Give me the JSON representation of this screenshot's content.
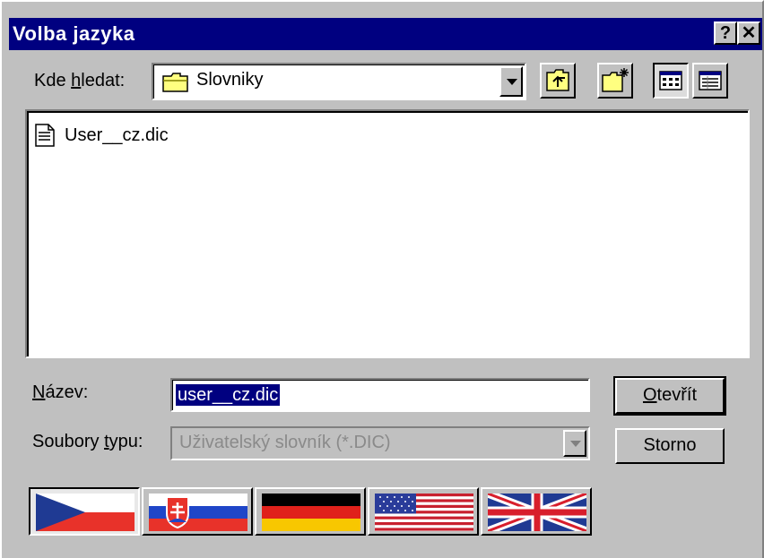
{
  "window": {
    "title": "Volba jazyka",
    "help_glyph": "?",
    "close_glyph": "✕"
  },
  "look_in": {
    "label_prefix": "Kde ",
    "label_accel": "h",
    "label_suffix": "ledat:",
    "value": "Slovniky",
    "icon": "folder-icon"
  },
  "toolbar": {
    "buttons": [
      {
        "name": "up-one-level",
        "icon": "folder-up-icon"
      },
      {
        "name": "create-new-folder",
        "icon": "new-folder-icon"
      },
      {
        "name": "list-view",
        "icon": "list-view-icon",
        "active": true
      },
      {
        "name": "details-view",
        "icon": "details-view-icon"
      }
    ]
  },
  "files": [
    {
      "name": "User__cz.dic",
      "icon": "document-icon"
    }
  ],
  "filename": {
    "label_accel": "N",
    "label_rest": "ázev:",
    "value": "user__cz.dic"
  },
  "filetype": {
    "label_prefix": "Soubory ",
    "label_accel": "t",
    "label_suffix": "ypu:",
    "value": "Uživatelský slovník (*.DIC)"
  },
  "buttons": {
    "open_accel": "O",
    "open_rest": "tevřít",
    "cancel": "Storno"
  },
  "languages": [
    {
      "name": "czech",
      "icon": "czech-flag-icon",
      "selected": true
    },
    {
      "name": "slovak",
      "icon": "slovak-flag-icon",
      "selected": false
    },
    {
      "name": "german",
      "icon": "german-flag-icon",
      "selected": false
    },
    {
      "name": "usa",
      "icon": "usa-flag-icon",
      "selected": false
    },
    {
      "name": "uk",
      "icon": "uk-flag-icon",
      "selected": false
    }
  ],
  "colors": {
    "titlebar": "#000080",
    "face": "#c0c0c0",
    "selection": "#000080"
  }
}
